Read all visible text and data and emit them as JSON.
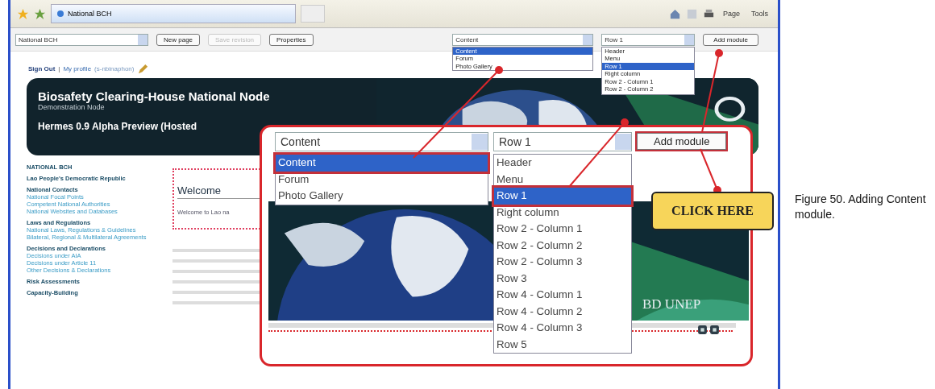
{
  "browser": {
    "tab_title": "National BCH",
    "menu": [
      {
        "label": "Page"
      },
      {
        "label": "Tools"
      }
    ]
  },
  "edit_bar": {
    "page_select": "National BCH",
    "buttons": [
      {
        "label": "New page",
        "disabled": false
      },
      {
        "label": "Save revision",
        "disabled": true
      },
      {
        "label": "Properties",
        "disabled": false
      }
    ],
    "module_select": {
      "value": "Content",
      "options": [
        {
          "label": "Content",
          "selected": true
        },
        {
          "label": "Forum",
          "selected": false
        },
        {
          "label": "Photo Gallery",
          "selected": false
        }
      ]
    },
    "position_select": {
      "value": "Row 1",
      "options": [
        {
          "label": "Header",
          "selected": false
        },
        {
          "label": "Menu",
          "selected": false
        },
        {
          "label": "Row 1",
          "selected": true
        },
        {
          "label": "Right column",
          "selected": false
        },
        {
          "label": "Row 2 - Column 1",
          "selected": false
        },
        {
          "label": "Row 2 - Column 2",
          "selected": false
        }
      ]
    },
    "add_button": "Add module"
  },
  "user_links": {
    "sign_out": "Sign Out",
    "separator": "|",
    "profile": "My profile",
    "user": "(s-nbinaphon)"
  },
  "banner": {
    "title": "Biosafety Clearing-House National Node",
    "subtitle": "Demonstration Node",
    "line": "Hermes 0.9 Alpha Preview (Hosted"
  },
  "sidebar": [
    {
      "heading": "NATIONAL BCH"
    },
    {
      "heading": "Lao People's Democratic Republic"
    },
    {
      "heading": "National Contacts",
      "items": [
        "National Focal Points",
        "Competent National Authorities",
        "National Websites and Databases"
      ]
    },
    {
      "heading": "Laws and Regulations",
      "items": [
        "National Laws, Regulations & Guidelines",
        "Bilateral, Regional & Multilateral Agreements"
      ]
    },
    {
      "heading": "Decisions and Declarations",
      "items": [
        "Decisions under AIA",
        "Decisions under Article 11",
        "Other Decisions & Declarations"
      ]
    },
    {
      "heading": "Risk Assessments"
    },
    {
      "heading": "Capacity-Building"
    }
  ],
  "welcome": {
    "title": "Welcome",
    "text": "Welcome to Lao na"
  },
  "zoom": {
    "module_select": {
      "value": "Content",
      "options": [
        {
          "label": "Content",
          "selected": true
        },
        {
          "label": "Forum",
          "selected": false
        },
        {
          "label": "Photo Gallery",
          "selected": false
        }
      ]
    },
    "position_select": {
      "value": "Row 1",
      "options": [
        {
          "label": "Header",
          "selected": false
        },
        {
          "label": "Menu",
          "selected": false
        },
        {
          "label": "Row 1",
          "selected": true
        },
        {
          "label": "Right column",
          "selected": false
        },
        {
          "label": "Row 2 - Column 1",
          "selected": false
        },
        {
          "label": "Row 2 - Column 2",
          "selected": false
        },
        {
          "label": "Row 2 - Column 3",
          "selected": false
        },
        {
          "label": "Row 3",
          "selected": false
        },
        {
          "label": "Row 4 - Column 1",
          "selected": false
        },
        {
          "label": "Row 4 - Column 2",
          "selected": false
        },
        {
          "label": "Row 4 - Column 3",
          "selected": false
        },
        {
          "label": "Row 5",
          "selected": false
        }
      ]
    },
    "add_button": "Add module",
    "logo_text": "BD UNEP"
  },
  "callout": "CLICK HERE",
  "caption": "Figure 50. Adding Content module."
}
